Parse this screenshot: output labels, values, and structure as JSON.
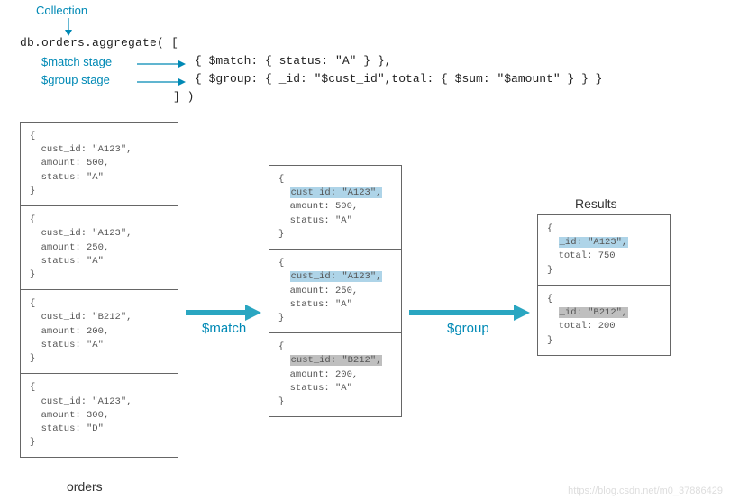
{
  "annotations": {
    "collection": "Collection",
    "match_stage": "$match stage",
    "group_stage": "$group stage"
  },
  "code": {
    "line1": "db.orders.aggregate( [",
    "match": "{ $match: { status: \"A\" } },",
    "group": "{ $group: { _id: \"$cust_id\",total: { $sum: \"$amount\" } } }",
    "close": "] )"
  },
  "columns": {
    "orders_label": "orders",
    "results_label": "Results"
  },
  "orders_docs": [
    {
      "cust_id": "cust_id: \"A123\",",
      "amount": "amount: 500,",
      "status": "status: \"A\"",
      "hl": "none"
    },
    {
      "cust_id": "cust_id: \"A123\",",
      "amount": "amount: 250,",
      "status": "status: \"A\"",
      "hl": "none"
    },
    {
      "cust_id": "cust_id: \"B212\",",
      "amount": "amount: 200,",
      "status": "status: \"A\"",
      "hl": "none"
    },
    {
      "cust_id": "cust_id: \"A123\",",
      "amount": "amount: 300,",
      "status": "status: \"D\"",
      "hl": "none"
    }
  ],
  "match_docs": [
    {
      "cust_id": "cust_id: \"A123\",",
      "amount": "amount: 500,",
      "status": "status: \"A\"",
      "hl": "blue"
    },
    {
      "cust_id": "cust_id: \"A123\",",
      "amount": "amount: 250,",
      "status": "status: \"A\"",
      "hl": "blue"
    },
    {
      "cust_id": "cust_id: \"B212\",",
      "amount": "amount: 200,",
      "status": "status: \"A\"",
      "hl": "grey"
    }
  ],
  "result_docs": [
    {
      "id": "_id: \"A123\",",
      "total": "total: 750",
      "hl": "blue"
    },
    {
      "id": "_id: \"B212\",",
      "total": "total: 200",
      "hl": "grey"
    }
  ],
  "ops": {
    "match": "$match",
    "group": "$group"
  },
  "watermark": "https://blog.csdn.net/m0_37886429",
  "colors": {
    "accent": "#0089b5",
    "arrow": "#2aa6c1"
  }
}
